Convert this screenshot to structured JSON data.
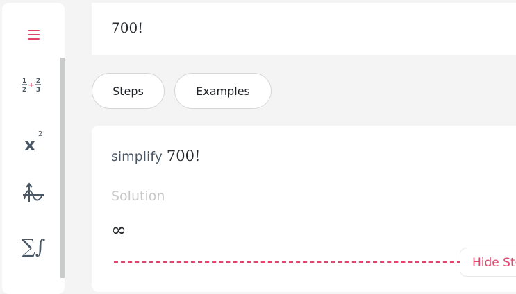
{
  "sidebar": {
    "items": [
      {
        "name": "menu"
      },
      {
        "name": "fractions",
        "num1": "1",
        "den1": "2",
        "plus": "+",
        "num2": "2",
        "den2": "3"
      },
      {
        "name": "exponent",
        "base": "x",
        "power": "2"
      },
      {
        "name": "functions"
      },
      {
        "name": "calculus",
        "glyph": "∑∫"
      }
    ]
  },
  "input": {
    "value": "700!"
  },
  "buttons": {
    "steps": "Steps",
    "examples": "Examples"
  },
  "result": {
    "prefix": "simplify",
    "expression": "700!",
    "solution_label": "Solution",
    "answer": "∞",
    "hide_steps": "Hide Steps"
  },
  "colors": {
    "accent": "#e0456a",
    "icon": "#4a5866"
  }
}
